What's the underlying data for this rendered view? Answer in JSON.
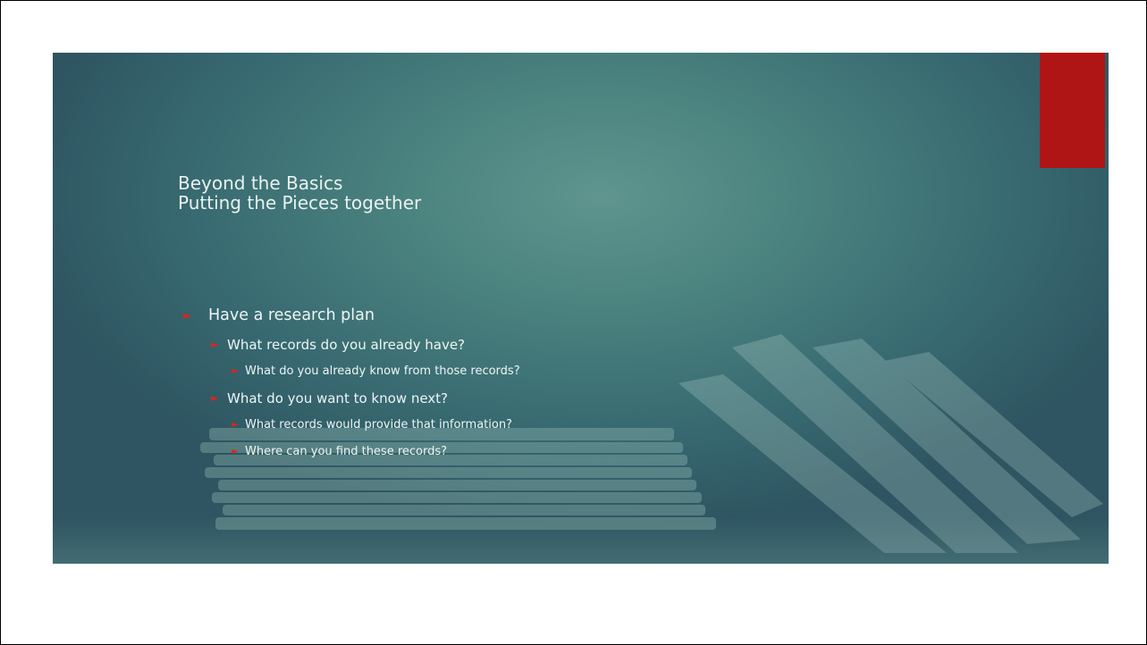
{
  "slide": {
    "title_lines": [
      "Beyond the Basics",
      "Putting the Pieces together"
    ],
    "bullets": [
      {
        "level": 1,
        "text": "Have a research plan"
      },
      {
        "level": 2,
        "text": "What records do you already have?"
      },
      {
        "level": 3,
        "text": "What do you already know from those records?"
      },
      {
        "level": 2,
        "text": "What do you want to know next?"
      },
      {
        "level": 3,
        "text": "What records would provide that information?"
      },
      {
        "level": 3,
        "text": "Where can you find these records?"
      }
    ],
    "bullet_icon": "triangle-right-icon"
  },
  "colors": {
    "accent": "#b01515",
    "bullet_arrow": "#d9261c",
    "background": "#4a827f",
    "text": "#eef5f4"
  }
}
